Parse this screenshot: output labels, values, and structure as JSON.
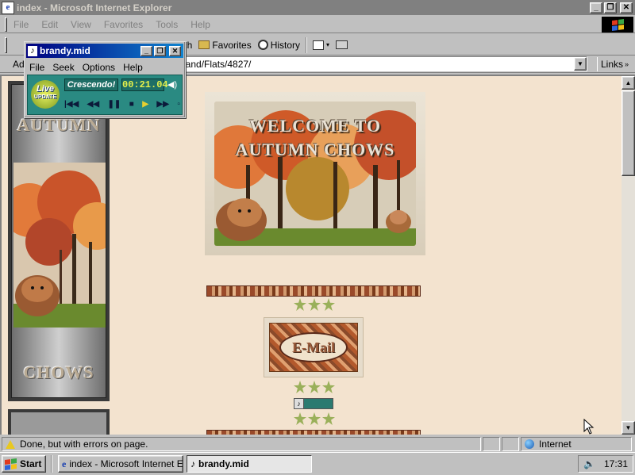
{
  "window": {
    "title": "index - Microsoft Internet Explorer",
    "app_icon": "ie-icon",
    "minimize": "_",
    "maximize": "❐",
    "close": "✕"
  },
  "menubar": {
    "items": [
      "File",
      "Edit",
      "View",
      "Favorites",
      "Tools",
      "Help"
    ]
  },
  "toolbar": {
    "search_label": "Search",
    "search_visible_fragment": "arch",
    "favorites_label": "Favorites",
    "history_label": "History"
  },
  "address": {
    "label": "Address",
    "label_visible": "Ad",
    "url_visible": "land/Flats/4827/",
    "links_label": "Links"
  },
  "page": {
    "sidebar_top_word": "AUTUMN",
    "sidebar_bottom_word": "CHOWS",
    "banner_line1": "WELCOME TO",
    "banner_line2": "AUTUMN CHOWS",
    "email_label": "E-Mail"
  },
  "statusbar": {
    "text": "Done, but with errors on page.",
    "zone": "Internet"
  },
  "taskbar": {
    "start_label": "Start",
    "tasks": [
      {
        "label": "index - Microsoft Internet E...",
        "active": false
      },
      {
        "label": "brandy.mid",
        "active": true
      }
    ],
    "clock": "17:31"
  },
  "player": {
    "title": "brandy.mid",
    "menu": [
      "File",
      "Seek",
      "Options",
      "Help"
    ],
    "logo_line1": "Live",
    "logo_line2": "UPDATE",
    "product": "Crescendo!",
    "time": "00:21.04"
  },
  "colors": {
    "page_background": "#f3e3cf",
    "title_bar_inactive": "#808080",
    "player_active_title": "#000080",
    "player_body": "#2a8a82",
    "time_display": "#e6f04a"
  }
}
